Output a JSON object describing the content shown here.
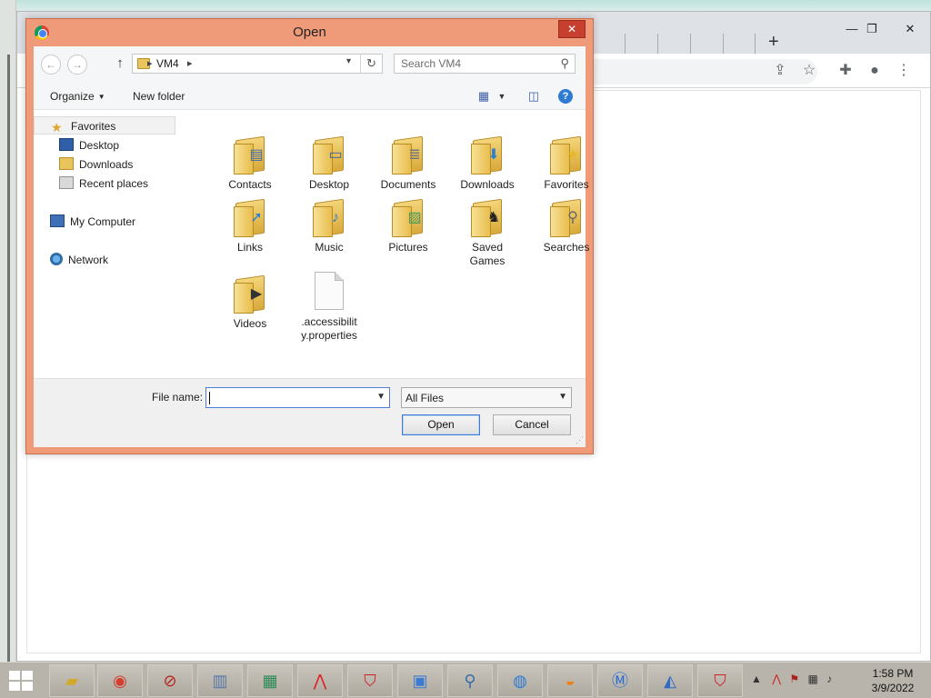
{
  "dialog": {
    "title": "Open",
    "close_glyph": "✕",
    "address": {
      "segments": [
        "VM4"
      ],
      "separator": "▸"
    },
    "search": {
      "placeholder": "Search VM4"
    },
    "toolbar": {
      "organize": "Organize",
      "new_folder": "New folder"
    },
    "nav": {
      "favorites": "Favorites",
      "desktop": "Desktop",
      "downloads": "Downloads",
      "recent": "Recent places",
      "computer": "My Computer",
      "network": "Network"
    },
    "files": [
      {
        "name": "Contacts",
        "icon": "contacts-folder-icon",
        "badge": "▤"
      },
      {
        "name": "Desktop",
        "icon": "desktop-folder-icon",
        "badge": "▭"
      },
      {
        "name": "Documents",
        "icon": "documents-folder-icon",
        "badge": "≣"
      },
      {
        "name": "Downloads",
        "icon": "downloads-folder-icon",
        "badge": "⬇"
      },
      {
        "name": "Favorites",
        "icon": "favorites-folder-icon",
        "badge": "★"
      },
      {
        "name": "Links",
        "icon": "links-folder-icon",
        "badge": "➚"
      },
      {
        "name": "Music",
        "icon": "music-folder-icon",
        "badge": "♪"
      },
      {
        "name": "Pictures",
        "icon": "pictures-folder-icon",
        "badge": "▨"
      },
      {
        "name": "Saved Games",
        "icon": "saved-games-folder-icon",
        "badge": "♞"
      },
      {
        "name": "Searches",
        "icon": "searches-folder-icon",
        "badge": "⚲"
      },
      {
        "name": "Videos",
        "icon": "videos-folder-icon",
        "badge": "▶"
      },
      {
        "name": ".accessibility.properties",
        "icon": "file-icon",
        "badge": ""
      }
    ],
    "file_name": {
      "label": "File name:",
      "value": ""
    },
    "file_type": {
      "selected": "All Files"
    },
    "buttons": {
      "open": "Open",
      "cancel": "Cancel"
    }
  },
  "taskbar": {
    "clock": {
      "time": "1:58 PM",
      "date": "3/9/2022"
    }
  },
  "colors": {
    "dialog_frame": "#ef9a79",
    "close_button": "#c7402f",
    "taskbar": "#b9b4ab"
  }
}
